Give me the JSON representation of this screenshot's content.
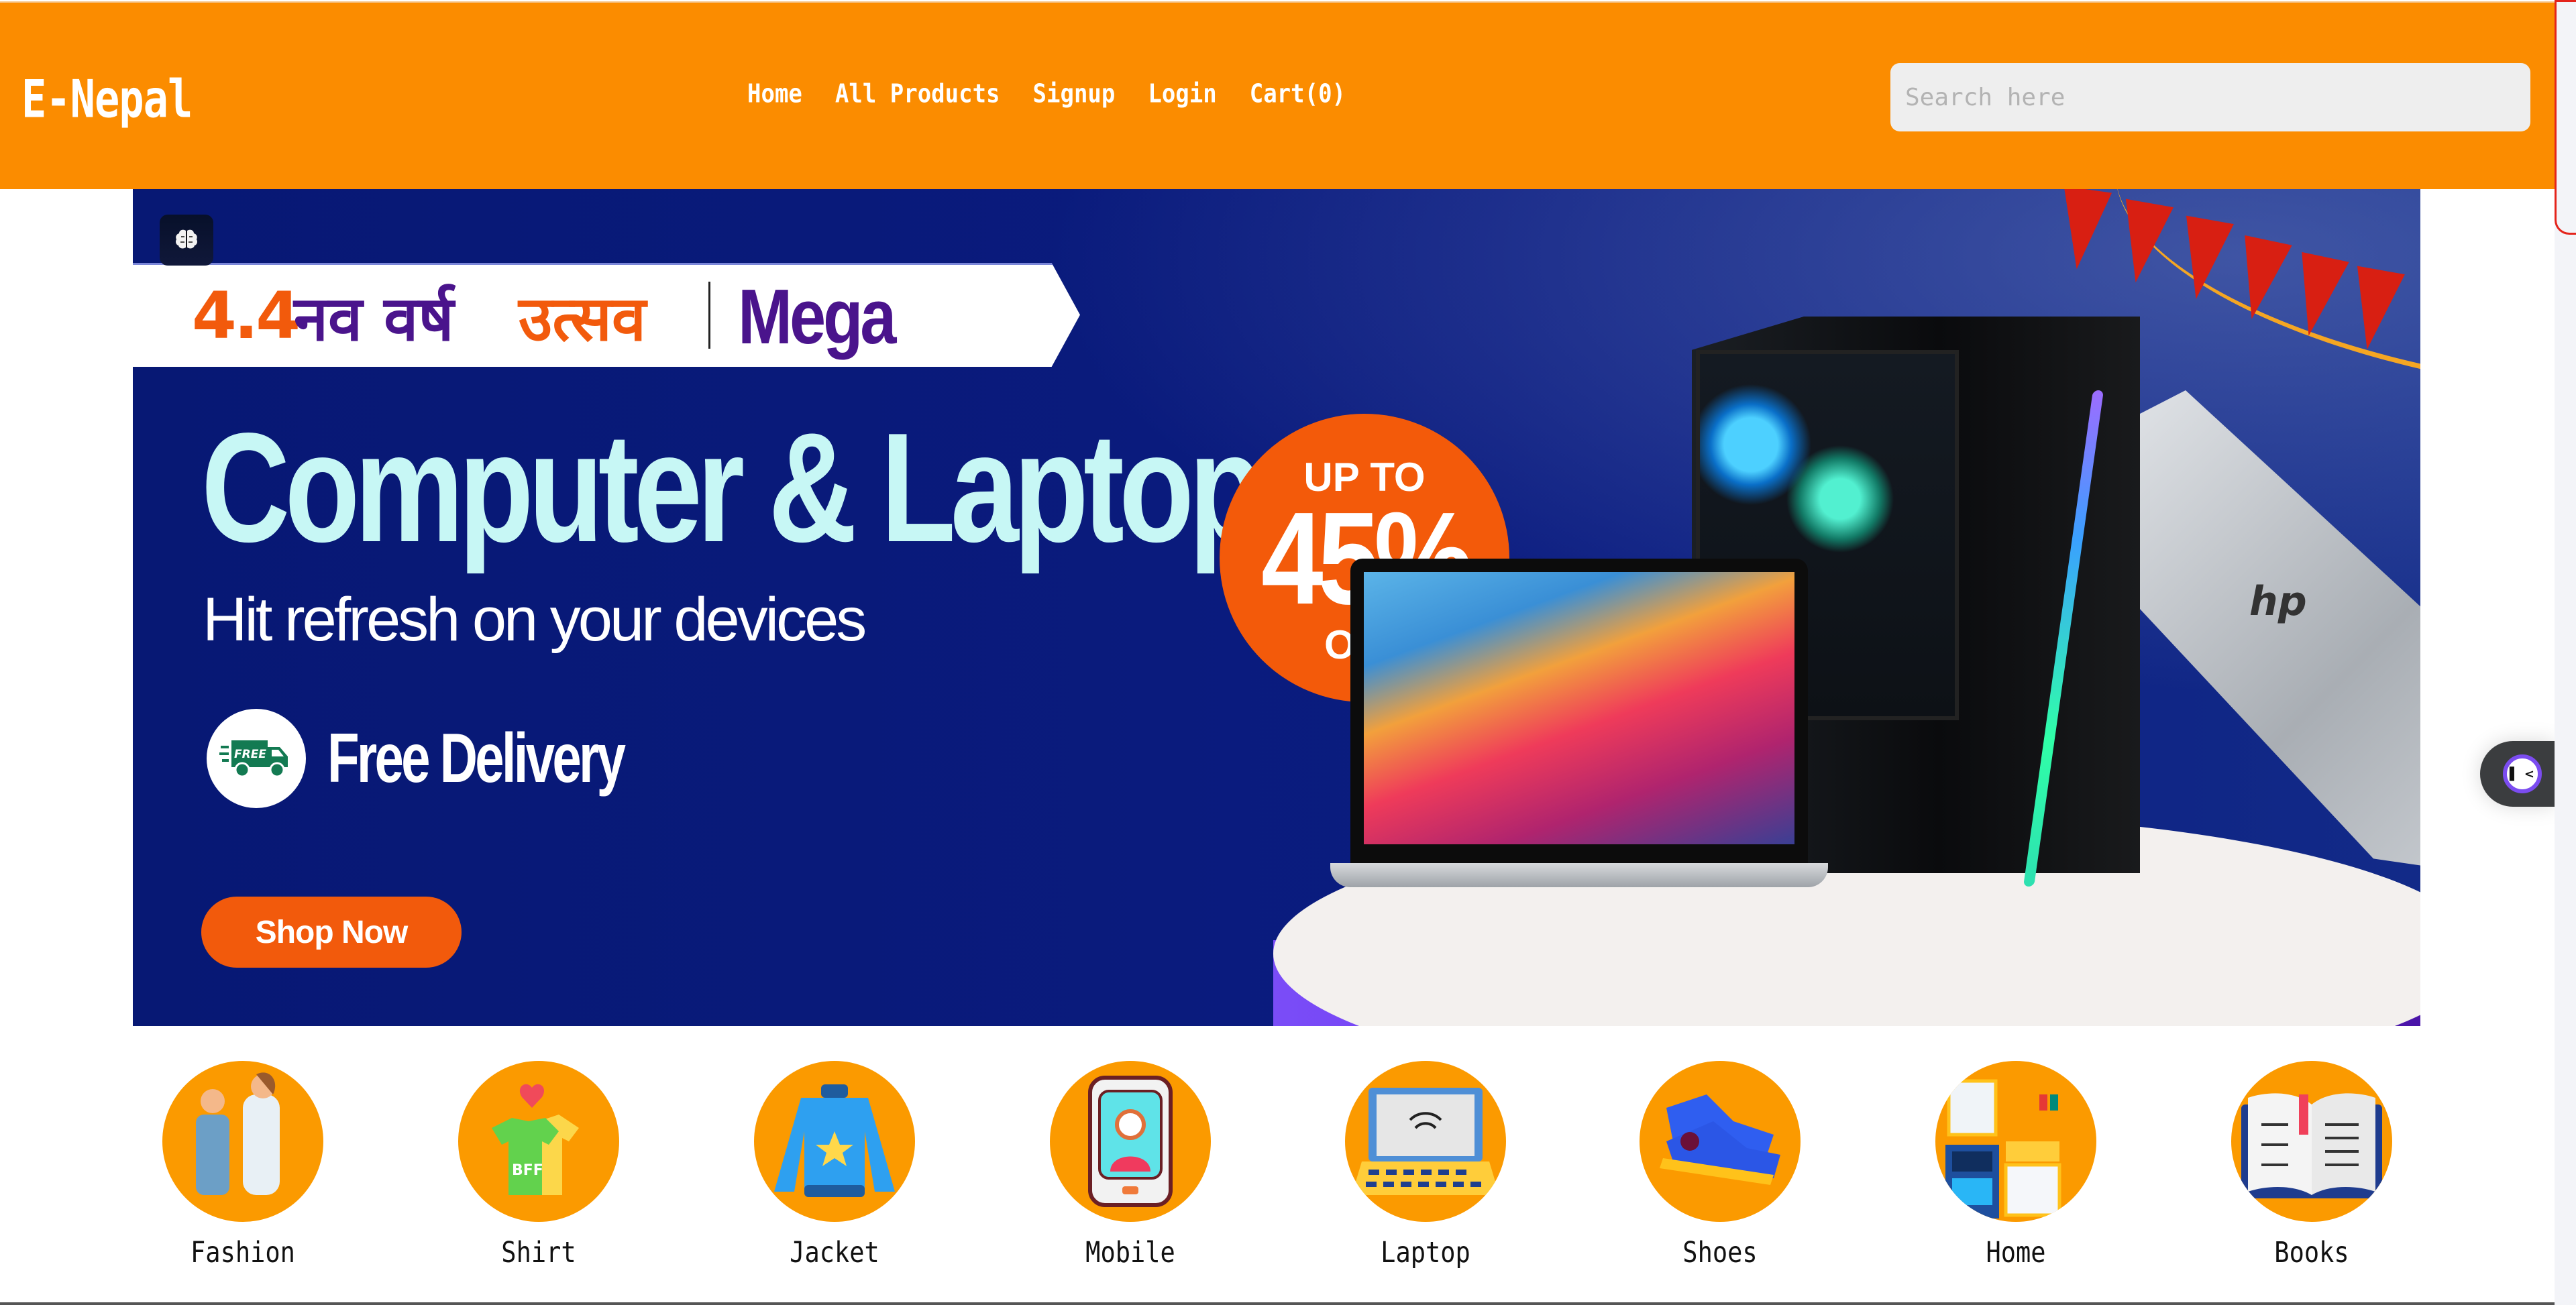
{
  "header": {
    "logo": "E-Nepal",
    "nav": [
      {
        "label": "Home"
      },
      {
        "label": "All Products"
      },
      {
        "label": "Signup"
      },
      {
        "label": "Login"
      },
      {
        "label": "Cart(0)"
      }
    ],
    "search": {
      "placeholder": "Search here",
      "value": ""
    }
  },
  "banner": {
    "ai_badge_icon": "brain-icon",
    "ribbon": {
      "number": "4.4",
      "devanagari_part1": "नव वर्ष",
      "devanagari_part2": "उत्सव",
      "tagline": "Mega Deals"
    },
    "headline": "Computer & Laptop",
    "subline": "Hit refresh on your devices",
    "free_badge": "FREE",
    "free_delivery": "Free Delivery",
    "shop_button": "Shop Now",
    "discount": {
      "prefix": "UP TO",
      "value": "45%",
      "suffix": "OFF"
    },
    "hp_logo": "hp",
    "colors": {
      "background": "#0a1a7a",
      "accent_orange": "#f25a0c",
      "headline": "#c7f7f5",
      "ribbon_purple": "#4a148c"
    }
  },
  "categories": [
    {
      "label": "Fashion",
      "icon": "fashion-couple-icon"
    },
    {
      "label": "Shirt",
      "icon": "shirt-icon"
    },
    {
      "label": "Jacket",
      "icon": "jacket-icon"
    },
    {
      "label": "Mobile",
      "icon": "mobile-icon"
    },
    {
      "label": "Laptop",
      "icon": "laptop-icon"
    },
    {
      "label": "Shoes",
      "icon": "shoes-icon"
    },
    {
      "label": "Home",
      "icon": "home-appliances-icon"
    },
    {
      "label": "Books",
      "icon": "book-icon"
    }
  ],
  "theme": {
    "header_bg": "#fb8c00",
    "category_circle": "#fb9a00"
  },
  "chat_widget": {
    "icon": "chat-assistant-icon"
  }
}
